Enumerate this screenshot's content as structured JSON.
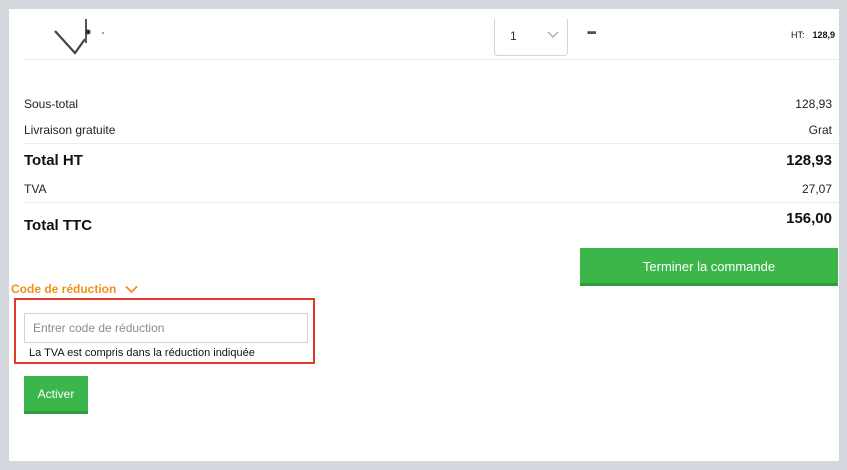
{
  "product_line": {
    "quantity": "1",
    "delete_glyph": "▪▪▪",
    "ht_label": "HT:",
    "ht_value": "128,9"
  },
  "summary": {
    "subtotal_label": "Sous-total",
    "subtotal_value": "128,93",
    "shipping_label": "Livraison gratuite",
    "shipping_value": "Grat",
    "total_ht_label": "Total HT",
    "total_ht_value": "128,93",
    "tva_label": "TVA",
    "tva_value": "27,07",
    "total_ttc_label": "Total TTC",
    "total_ttc_value": "156,00"
  },
  "checkout_button": "Terminer la commande",
  "discount": {
    "toggle_label": "Code de réduction",
    "placeholder": "Entrer code de réduction",
    "note": "La TVA est compris dans la réduction indiquée",
    "activate_button": "Activer"
  },
  "colors": {
    "accent_green": "#3cb64a",
    "accent_orange": "#f09019",
    "highlight_red": "#e0392a"
  },
  "icons": {
    "product": "product-thumbnail-icon",
    "select_chevron": "chevron-down-icon",
    "toggle_chevron": "chevron-down-icon",
    "delete": "delete-icon"
  }
}
